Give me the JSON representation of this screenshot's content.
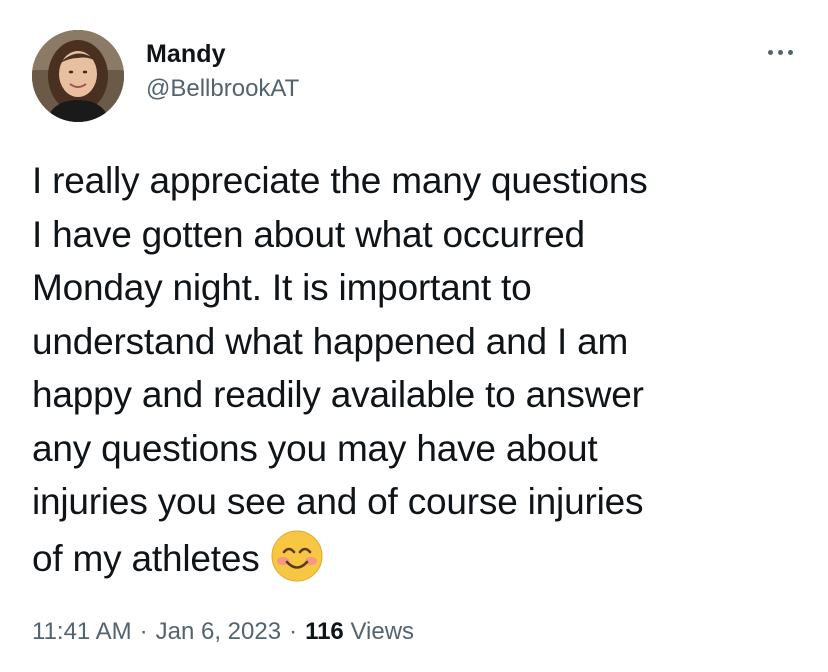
{
  "author": {
    "display_name": "Mandy",
    "handle": "@BellbrookAT"
  },
  "more_icon": "more-horizontal-icon",
  "tweet": {
    "lines": [
      "I really appreciate the many questions",
      "I have gotten about what occurred",
      "Monday night. It is important to",
      "understand what happened and I am",
      "happy and readily available to answer",
      "any questions you may have about",
      "injuries you see and of course injuries",
      "of my athletes"
    ],
    "emoji": "smiling-face-with-smiling-eyes"
  },
  "meta": {
    "time": "11:41 AM",
    "separator": "·",
    "date": "Jan 6, 2023",
    "views_count": "116",
    "views_label": "Views"
  },
  "colors": {
    "text": "#0f1419",
    "secondary": "#536471",
    "emoji_face": "#f7c744"
  }
}
